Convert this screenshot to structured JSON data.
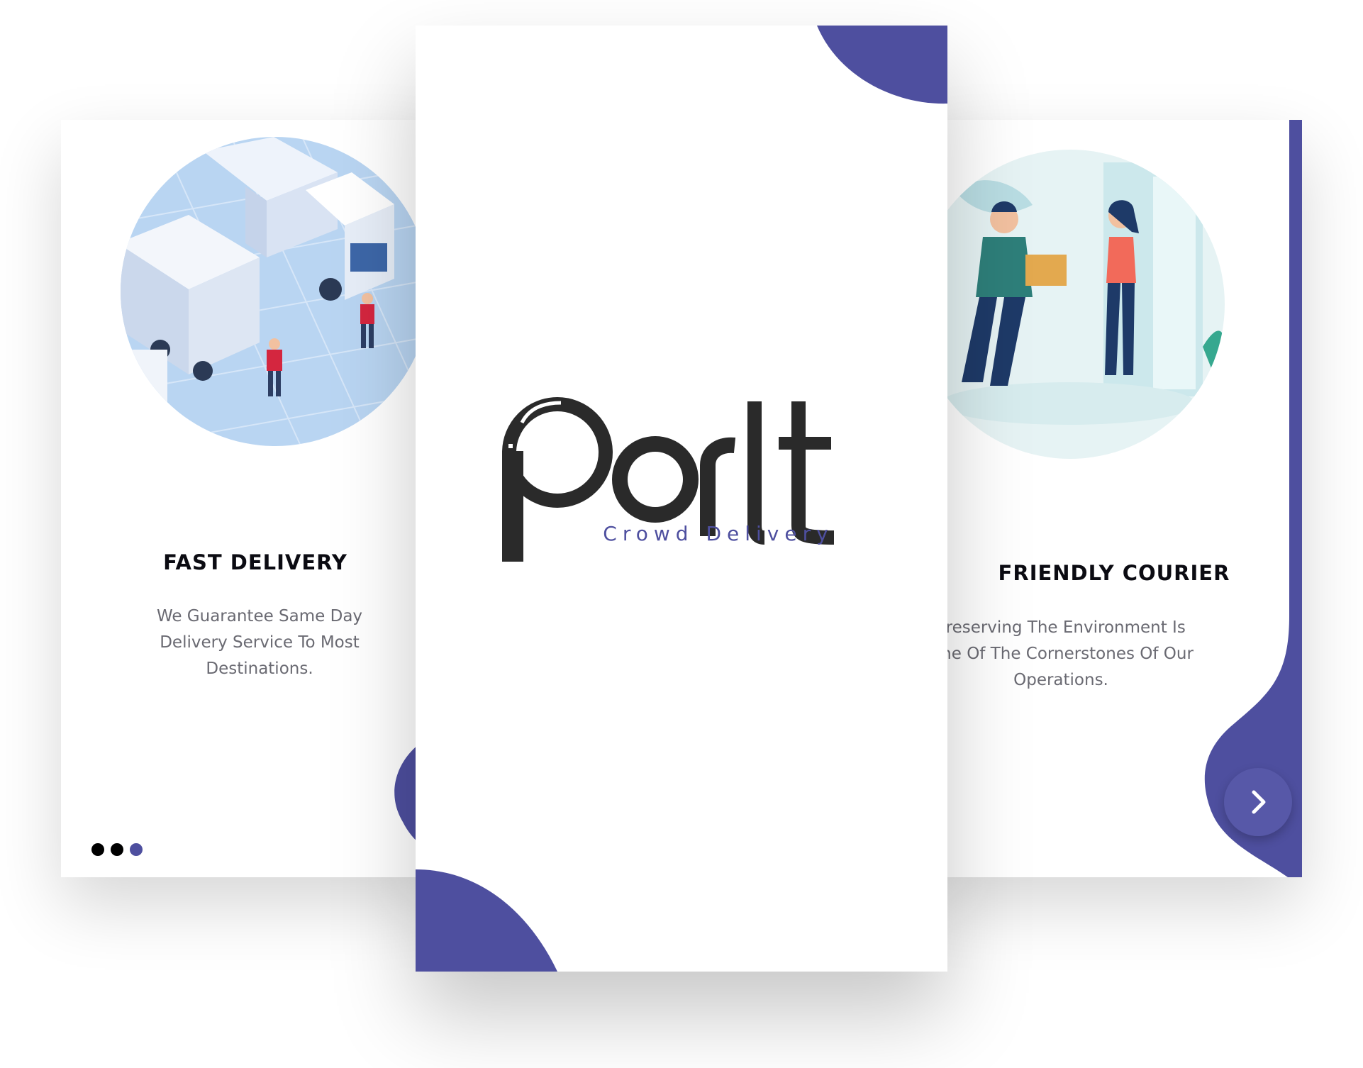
{
  "brand": {
    "logo_text": "Porlt",
    "tagline": "Crowd Delivery",
    "accent_color": "#4e4f9f"
  },
  "screens": {
    "left": {
      "title": "FAST DELIVERY",
      "description": "We Guarantee Same Day Delivery Service To Most Destinations.",
      "illustration": "delivery-trucks-illustration",
      "pager": {
        "count": 3,
        "active_index": 3
      }
    },
    "right": {
      "title": "FRIENDLY COURIER",
      "description": "Preserving The Environment Is One Of The Cornerstones Of Our Operations.",
      "illustration": "courier-handing-package-illustration",
      "next_icon": "chevron-right-icon"
    }
  }
}
